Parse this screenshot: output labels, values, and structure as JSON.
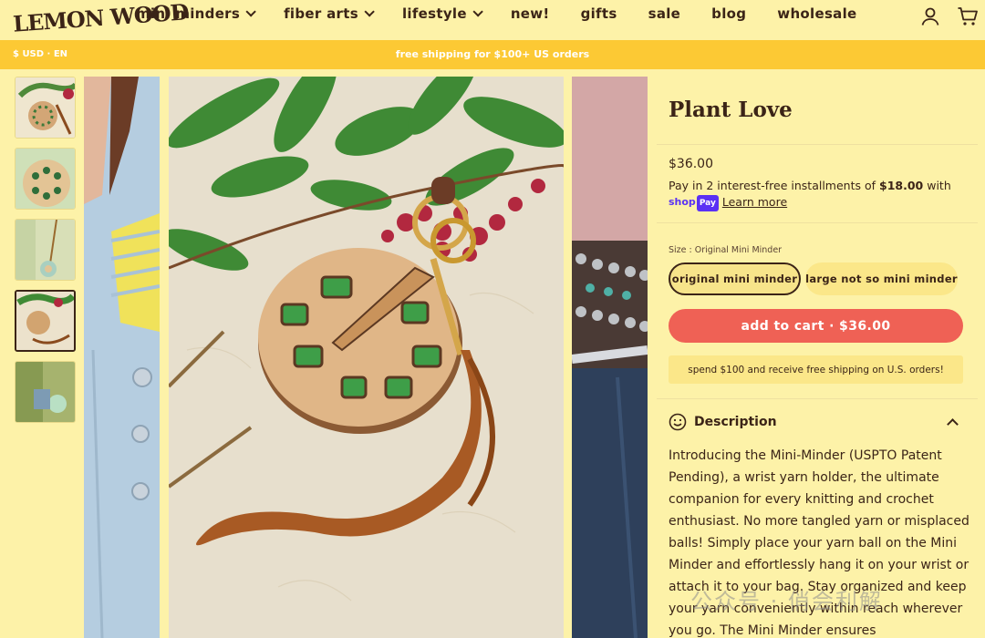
{
  "header": {
    "logo_text": "LEMON WOOD",
    "nav": [
      {
        "label": "mini minders",
        "dropdown": true
      },
      {
        "label": "fiber arts",
        "dropdown": true
      },
      {
        "label": "lifestyle",
        "dropdown": true
      },
      {
        "label": "new!",
        "dropdown": false
      },
      {
        "label": "gifts",
        "dropdown": false
      },
      {
        "label": "sale",
        "dropdown": false
      },
      {
        "label": "blog",
        "dropdown": false
      },
      {
        "label": "wholesale",
        "dropdown": false
      }
    ],
    "icons": [
      "account-icon",
      "cart-icon"
    ]
  },
  "announcement": {
    "currency": "$ USD · EN",
    "message": "free shipping for $100+ US orders"
  },
  "gallery": {
    "thumbnail_count": 5,
    "active_thumbnail": 4
  },
  "product": {
    "title": "Plant Love",
    "price": "$36.00",
    "installments_prefix": "Pay in 2 interest-free installments of ",
    "installments_amount": "$18.00",
    "installments_suffix": " with",
    "shop_pay_label": "shop",
    "shop_pay_badge": "Pay",
    "learn_more": "Learn more",
    "size_label": "Size : Original Mini Minder",
    "options": [
      "original mini minder",
      "large not so mini minder"
    ],
    "selected_option": "original mini minder",
    "add_to_cart": "add to cart · $36.00",
    "promo": "spend $100 and receive free shipping on U.S. orders!",
    "description_heading": "Description",
    "description_text": "Introducing the Mini-Minder (USPTO Patent Pending), a wrist yarn holder, the ultimate companion for every knitting and crochet enthusiast. No more tangled yarn or misplaced balls! Simply place your yarn ball on the Mini Minder and effortlessly hang it on your wrist or attach it to your bag. Stay organized and keep your yarn conveniently within reach wherever you go. The Mini Minder ensures"
  },
  "watermark": "公众号 · 俏会利解",
  "colors": {
    "background": "#fdf2a8",
    "announcement": "#fcc934",
    "add_to_cart": "#ef6155",
    "option_bg": "#fbe789",
    "text": "#3b2417"
  }
}
